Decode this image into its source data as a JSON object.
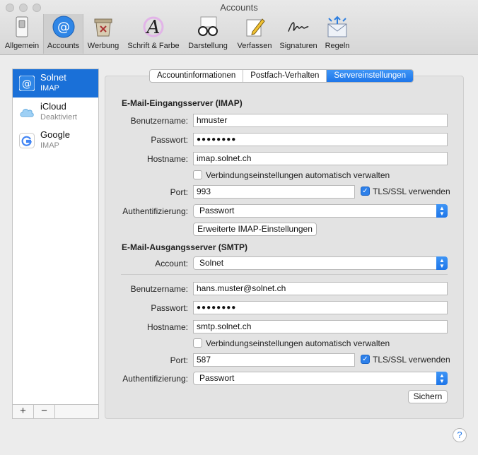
{
  "window": {
    "title": "Accounts"
  },
  "toolbar": [
    {
      "label": "Allgemein",
      "icon": "switch-icon"
    },
    {
      "label": "Accounts",
      "icon": "at-icon"
    },
    {
      "label": "Werbung",
      "icon": "junk-bin-icon"
    },
    {
      "label": "Schrift & Farbe",
      "icon": "font-color-icon"
    },
    {
      "label": "Darstellung",
      "icon": "glasses-icon"
    },
    {
      "label": "Verfassen",
      "icon": "compose-icon"
    },
    {
      "label": "Signaturen",
      "icon": "signature-icon"
    },
    {
      "label": "Regeln",
      "icon": "rules-icon"
    }
  ],
  "accounts": [
    {
      "name": "Solnet",
      "type": "IMAP",
      "icon": "at-icon"
    },
    {
      "name": "iCloud",
      "type": "Deaktiviert",
      "icon": "cloud-icon"
    },
    {
      "name": "Google",
      "type": "IMAP",
      "icon": "google-icon"
    }
  ],
  "sidebar_buttons": {
    "add": "+",
    "remove": "−"
  },
  "tabs": [
    "Accountinformationen",
    "Postfach-Verhalten",
    "Servereinstellungen"
  ],
  "incoming": {
    "title": "E-Mail-Eingangsserver (IMAP)",
    "username_label": "Benutzername:",
    "username": "hmuster",
    "password_label": "Passwort:",
    "password": "●●●●●●●●",
    "hostname_label": "Hostname:",
    "hostname": "imap.solnet.ch",
    "auto_label": "Verbindungseinstellungen automatisch verwalten",
    "port_label": "Port:",
    "port": "993",
    "tls_label": "TLS/SSL verwenden",
    "auth_label": "Authentifizierung:",
    "auth": "Passwort",
    "advanced_button": "Erweiterte IMAP-Einstellungen"
  },
  "outgoing": {
    "title": "E-Mail-Ausgangsserver (SMTP)",
    "account_label": "Account:",
    "account": "Solnet",
    "username_label": "Benutzername:",
    "username": "hans.muster@solnet.ch",
    "password_label": "Passwort:",
    "password": "●●●●●●●●",
    "hostname_label": "Hostname:",
    "hostname": "smtp.solnet.ch",
    "auto_label": "Verbindungseinstellungen automatisch verwalten",
    "port_label": "Port:",
    "port": "587",
    "tls_label": "TLS/SSL verwenden",
    "auth_label": "Authentifizierung:",
    "auth": "Passwort"
  },
  "save_button": "Sichern",
  "help_button": "?"
}
